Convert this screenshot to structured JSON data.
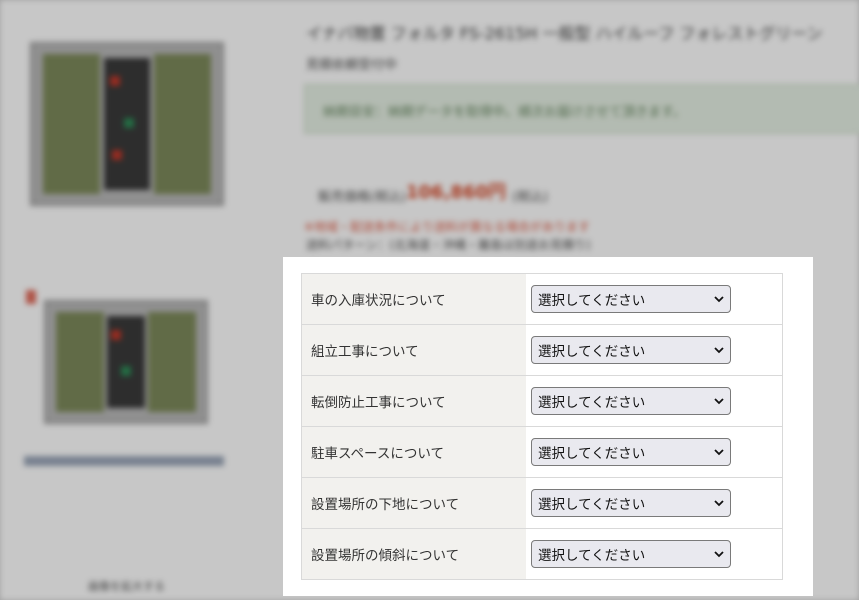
{
  "background": {
    "product_title": "イナバ物置 フォルタ FS-2615H 一般型 ハイルーフ フォレストグリーン",
    "option_note": "見積依頼受付中",
    "notice_text": "納期目安：納期データを取得中。順次お届けさせて頂きます。",
    "price_label": "販売価格(税込)",
    "price": "106,860円",
    "price_suffix": "(税込)",
    "red_notice": "※地域・配送条件により送料が異なる場合があります",
    "shipping_text": "送料パターン：(北海道・沖縄・離島は別途お見積り)",
    "thumb_caption": "画像を拡大する"
  },
  "form": {
    "rows": [
      {
        "label": "車の入庫状況について",
        "selected": "選択してください"
      },
      {
        "label": "組立工事について",
        "selected": "選択してください"
      },
      {
        "label": "転倒防止工事について",
        "selected": "選択してください"
      },
      {
        "label": "駐車スペースについて",
        "selected": "選択してください"
      },
      {
        "label": "設置場所の下地について",
        "selected": "選択してください"
      },
      {
        "label": "設置場所の傾斜について",
        "selected": "選択してください"
      }
    ]
  },
  "icons": {
    "dropdown": "chevron-down-icon"
  }
}
